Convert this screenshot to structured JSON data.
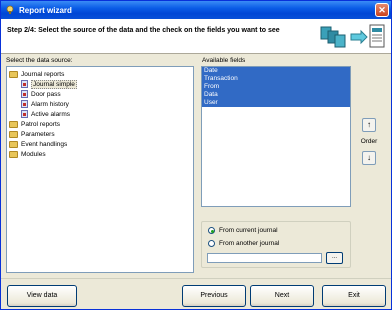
{
  "window": {
    "title": "Report wizard"
  },
  "header": {
    "step_text": "Step 2/4: Select the source of the data and the check on the fields you want to see"
  },
  "data_source": {
    "label": "Select the data source:",
    "tree": [
      {
        "label": "Journal reports",
        "type": "folder",
        "level": 0
      },
      {
        "label": "Journal simple",
        "type": "report",
        "level": 1,
        "selected": true
      },
      {
        "label": "Door pass",
        "type": "report",
        "level": 1
      },
      {
        "label": "Alarm history",
        "type": "report",
        "level": 1
      },
      {
        "label": "Active alarms",
        "type": "report",
        "level": 1
      },
      {
        "label": "Patrol reports",
        "type": "folder",
        "level": 0
      },
      {
        "label": "Parameters",
        "type": "folder",
        "level": 0
      },
      {
        "label": "Event handlings",
        "type": "folder",
        "level": 0
      },
      {
        "label": "Modules",
        "type": "folder",
        "level": 0
      }
    ]
  },
  "fields": {
    "label": "Available fields",
    "items": [
      "Date",
      "Transaction",
      "From",
      "Data",
      "User"
    ]
  },
  "order": {
    "label": "Order",
    "up": "↑",
    "down": "↓"
  },
  "journal_source": {
    "option_current": "From current journal",
    "option_another": "From another journal",
    "selected": "current",
    "path_value": "",
    "browse_label": "..."
  },
  "buttons": {
    "view_data": "View data",
    "previous": "Previous",
    "next": "Next",
    "exit": "Exit"
  },
  "colors": {
    "selection": "#316ac5",
    "titlebar": "#0a5ce6"
  }
}
